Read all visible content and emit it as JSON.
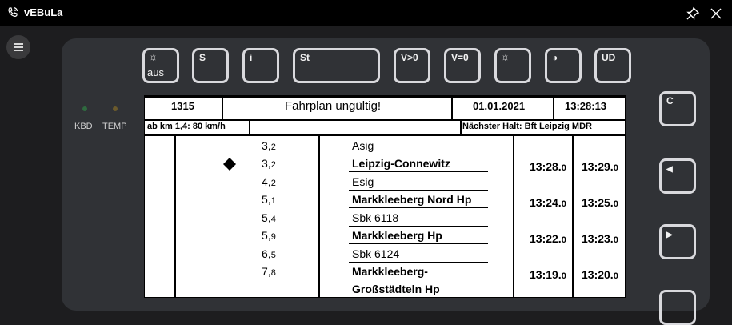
{
  "window": {
    "title": "vEBuLa"
  },
  "top_buttons": {
    "bright_sub": "aus",
    "s": "S",
    "i": "i",
    "st": "St",
    "v_gt0": "V>0",
    "v_eq0": "V=0",
    "ud": "UD"
  },
  "side_buttons": {
    "c": "C"
  },
  "indicators": {
    "kbd": "KBD",
    "temp": "TEMP"
  },
  "header": {
    "train": "1315",
    "status": "Fahrplan ungültig!",
    "date": "01.01.2021",
    "time": "13:28:13"
  },
  "info_row": {
    "speed_limit": "ab km 1,4: 80 km/h",
    "next_stop": "Nächster Halt: Bft Leipzig MDR"
  },
  "rows": [
    {
      "km_int": "3,",
      "km_dec": "2",
      "station": "Asig",
      "bold": false
    },
    {
      "km_int": "3,",
      "km_dec": "2",
      "station": "Leipzig-Connewitz",
      "bold": true,
      "arr": "13:28.",
      "arr_dec": "0",
      "dep": "13:29.",
      "dep_dec": "0"
    },
    {
      "km_int": "4,",
      "km_dec": "2",
      "station": "Esig",
      "bold": false
    },
    {
      "km_int": "5,",
      "km_dec": "1",
      "station": "Markkleeberg Nord Hp",
      "bold": true,
      "arr": "13:24.",
      "arr_dec": "0",
      "dep": "13:25.",
      "dep_dec": "0"
    },
    {
      "km_int": "5,",
      "km_dec": "4",
      "station": "Sbk 6118",
      "bold": false
    },
    {
      "km_int": "5,",
      "km_dec": "9",
      "station": "Markkleeberg Hp",
      "bold": true,
      "arr": "13:22.",
      "arr_dec": "0",
      "dep": "13:23.",
      "dep_dec": "0"
    },
    {
      "km_int": "6,",
      "km_dec": "5",
      "station": "Sbk 6124",
      "bold": false
    },
    {
      "km_int": "7,",
      "km_dec": "8",
      "station_line1": "Markkleeberg-",
      "station_line2": "Großstädteln Hp",
      "bold": true,
      "arr": "13:19.",
      "arr_dec": "0",
      "dep": "13:20.",
      "dep_dec": "0"
    }
  ]
}
